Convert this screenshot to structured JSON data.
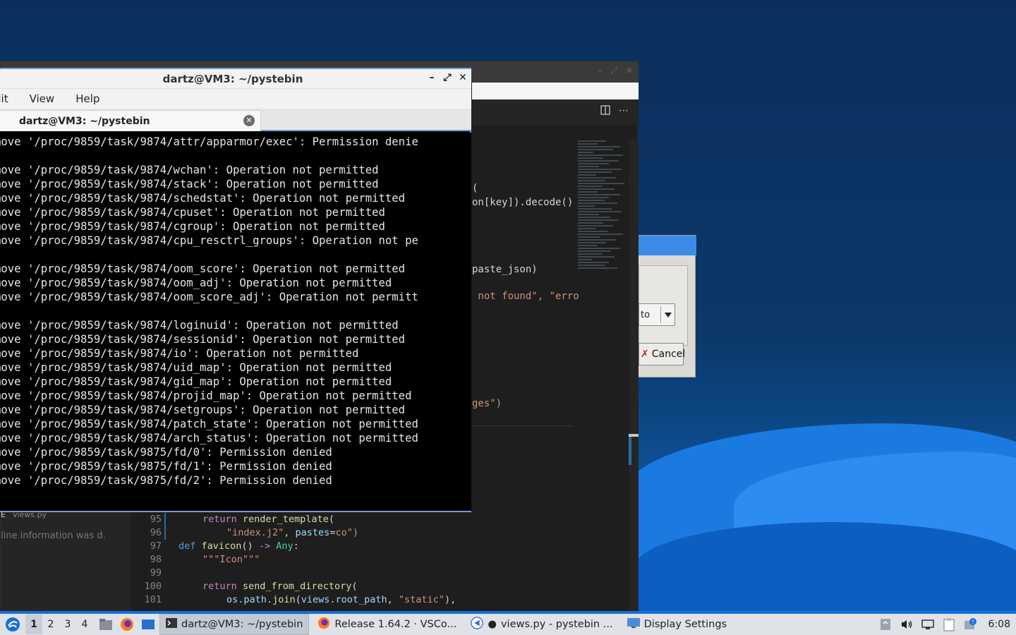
{
  "terminal": {
    "title": "dartz@VM3: ~/pystebin",
    "menu": [
      "dit",
      "View",
      "Help"
    ],
    "tab_label": "dartz@VM3: ~/pystebin",
    "lines": [
      "move '/proc/9859/task/9874/attr/apparmor/exec': Permission denie",
      "",
      "move '/proc/9859/task/9874/wchan': Operation not permitted",
      "move '/proc/9859/task/9874/stack': Operation not permitted",
      "move '/proc/9859/task/9874/schedstat': Operation not permitted",
      "move '/proc/9859/task/9874/cpuset': Operation not permitted",
      "move '/proc/9859/task/9874/cgroup': Operation not permitted",
      "move '/proc/9859/task/9874/cpu_resctrl_groups': Operation not pe",
      "",
      "move '/proc/9859/task/9874/oom_score': Operation not permitted",
      "move '/proc/9859/task/9874/oom_adj': Operation not permitted",
      "move '/proc/9859/task/9874/oom_score_adj': Operation not permitt",
      "",
      "move '/proc/9859/task/9874/loginuid': Operation not permitted",
      "move '/proc/9859/task/9874/sessionid': Operation not permitted",
      "move '/proc/9859/task/9874/io': Operation not permitted",
      "move '/proc/9859/task/9874/uid_map': Operation not permitted",
      "move '/proc/9859/task/9874/gid_map': Operation not permitted",
      "move '/proc/9859/task/9874/projid_map': Operation not permitted",
      "move '/proc/9859/task/9874/setgroups': Operation not permitted",
      "move '/proc/9859/task/9874/patch_state': Operation not permitted",
      "move '/proc/9859/task/9874/arch_status': Operation not permitted",
      "move '/proc/9859/task/9875/fd/0': Permission denied",
      "move '/proc/9859/task/9875/fd/1': Permission denied",
      "move '/proc/9859/task/9875/fd/2': Permission denied"
    ]
  },
  "vscode": {
    "sidebar_file": "views.py",
    "sidebar_file_prefix": "E",
    "sidebar_info": "line information was d.",
    "fragments": {
      "f1": "(",
      "f2": "on[key]).decode()",
      "f3": "paste_json)",
      "f4a": " not found\", ",
      "f4b": "\"erro",
      "f5": "ges\")"
    },
    "code": [
      {
        "ln": "95",
        "t": "return render_template("
      },
      {
        "ln": "96",
        "t": "\"index.j2\", pastes=co\")"
      },
      {
        "ln": "97",
        "t": "def favicon() -> Any:"
      },
      {
        "ln": "98",
        "t": "\"\"\"Icon\"\"\""
      },
      {
        "ln": "99",
        "t": ""
      },
      {
        "ln": "100",
        "t": "return send_from_directory("
      },
      {
        "ln": "101",
        "t": "os.path.join(views.root_path, \"static\"),"
      }
    ]
  },
  "dialog": {
    "combo_value": "to",
    "cancel_label": "Cancel"
  },
  "taskbar": {
    "workspaces": [
      "1",
      "2",
      "3",
      "4"
    ],
    "tasks": [
      "dartz@VM3: ~/pystebin",
      "Release 1.64.2 · VSCo...",
      "views.py - pystebin ...",
      "Display Settings"
    ],
    "clock": "6:08"
  },
  "colors": {
    "accent": "#1570d6",
    "terminal_bg": "#000000",
    "editor_bg": "#1e1e1e"
  }
}
